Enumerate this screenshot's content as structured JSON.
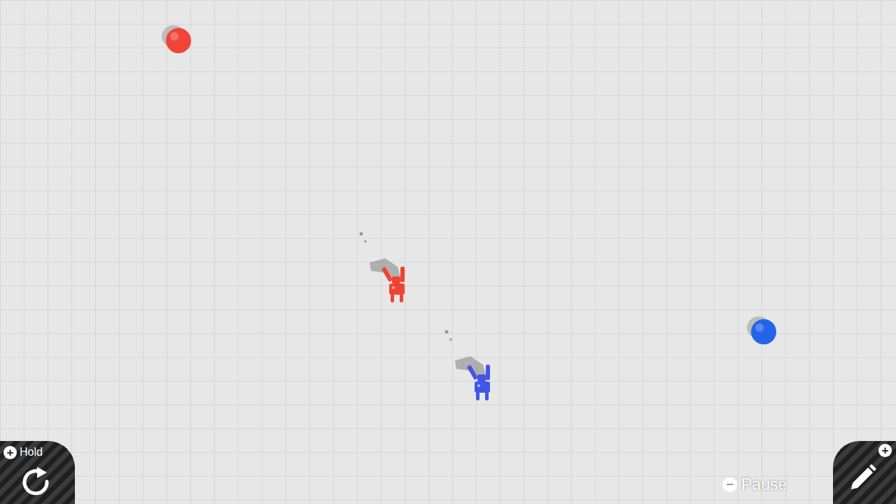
{
  "objects": [
    {
      "kind": "ball",
      "color": "#f0443a"
    },
    {
      "kind": "ball",
      "color": "#2563eb"
    },
    {
      "kind": "robot",
      "color": "#ef4434"
    },
    {
      "kind": "robot",
      "color": "#4256e6"
    }
  ],
  "hud": {
    "hold_button": {
      "key": "+",
      "label": "Hold"
    },
    "edit_button": {
      "key": "+"
    },
    "pause": {
      "key": "−",
      "label": "Pause"
    }
  }
}
